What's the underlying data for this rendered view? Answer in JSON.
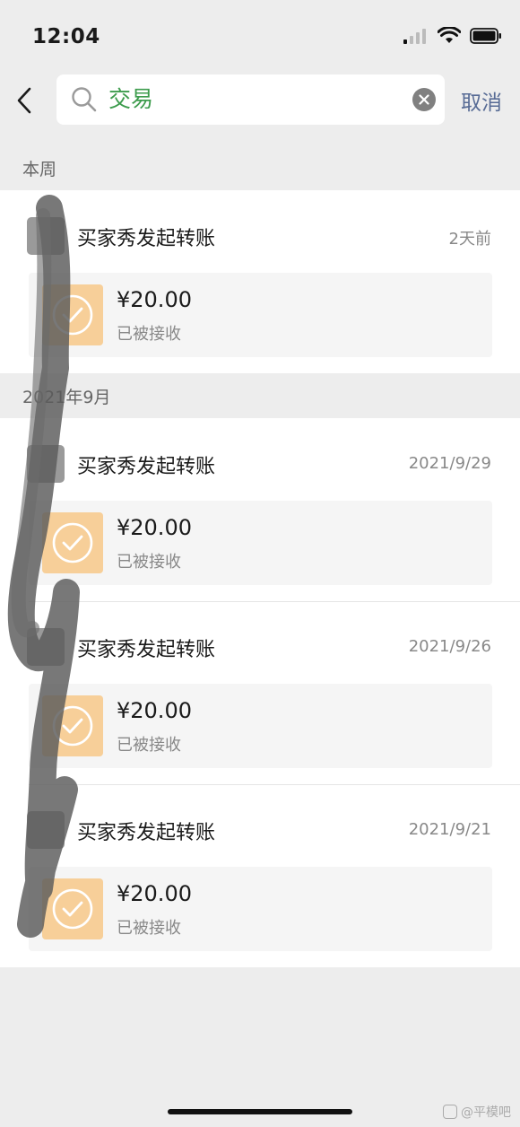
{
  "status_bar": {
    "time": "12:04"
  },
  "search": {
    "query": "交易",
    "cancel_label": "取消"
  },
  "sections": [
    {
      "label": "本周",
      "records": [
        {
          "title": "买家秀发起转账",
          "date": "2天前",
          "amount": "¥20.00",
          "status": "已被接收"
        }
      ]
    },
    {
      "label": "2021年9月",
      "records": [
        {
          "title": "买家秀发起转账",
          "date": "2021/9/29",
          "amount": "¥20.00",
          "status": "已被接收"
        },
        {
          "title": "买家秀发起转账",
          "date": "2021/9/26",
          "amount": "¥20.00",
          "status": "已被接收"
        },
        {
          "title": "买家秀发起转账",
          "date": "2021/9/21",
          "amount": "¥20.00",
          "status": "已被接收"
        }
      ]
    }
  ],
  "watermark": "@平模吧",
  "colors": {
    "background": "#ededed",
    "search_text": "#3d9c4d",
    "link": "#576b95",
    "transfer_card_icon": "#f7cf99"
  },
  "icons": {
    "back": "chevron-left-icon",
    "search": "search-icon",
    "clear": "clear-icon",
    "transfer_accepted": "check-circle-icon"
  }
}
